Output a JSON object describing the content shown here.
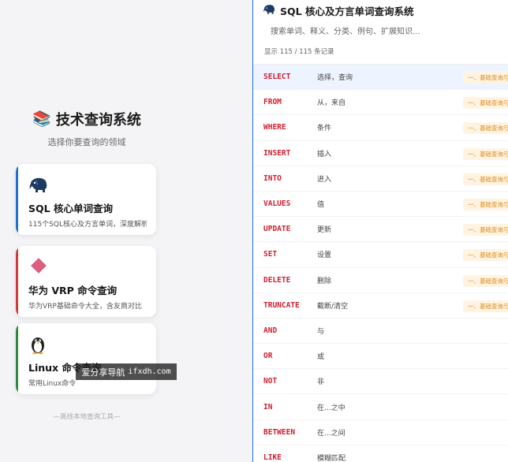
{
  "home": {
    "title": "技术查询系统",
    "subtitle": "选择你要查询的领域",
    "footer": "—离线本地查询工具—",
    "cards": [
      {
        "title": "SQL 核心单词查询",
        "desc": "115个SQL核心及方言单词，深度解析"
      },
      {
        "title": "华为 VRP 命令查询",
        "desc": "华为VRP基础命令大全，含友商对比"
      },
      {
        "title": "Linux 命令查询",
        "desc": "常用Linux命令"
      }
    ]
  },
  "watermark": {
    "text": "爱分享导航",
    "url": "ifxdh.com"
  },
  "panel": {
    "title": "SQL 核心及方言单词查询系统",
    "search_placeholder": "搜索单词、释义、分类、例句、扩展知识...",
    "count": "显示 115 / 115 条记录",
    "rows": [
      {
        "kw": "SELECT",
        "meaning": "选择，查询",
        "tag": "一、基础查询与"
      },
      {
        "kw": "FROM",
        "meaning": "从，来自",
        "tag": "一、基础查询与"
      },
      {
        "kw": "WHERE",
        "meaning": "条件",
        "tag": "一、基础查询与"
      },
      {
        "kw": "INSERT",
        "meaning": "插入",
        "tag": "一、基础查询与"
      },
      {
        "kw": "INTO",
        "meaning": "进入",
        "tag": "一、基础查询与"
      },
      {
        "kw": "VALUES",
        "meaning": "值",
        "tag": "一、基础查询与"
      },
      {
        "kw": "UPDATE",
        "meaning": "更新",
        "tag": "一、基础查询与"
      },
      {
        "kw": "SET",
        "meaning": "设置",
        "tag": "一、基础查询与"
      },
      {
        "kw": "DELETE",
        "meaning": "删除",
        "tag": "一、基础查询与"
      },
      {
        "kw": "TRUNCATE",
        "meaning": "截断/清空",
        "tag": "一、基础查询与"
      },
      {
        "kw": "AND",
        "meaning": "与",
        "tag": ""
      },
      {
        "kw": "OR",
        "meaning": "或",
        "tag": ""
      },
      {
        "kw": "NOT",
        "meaning": "非",
        "tag": ""
      },
      {
        "kw": "IN",
        "meaning": "在...之中",
        "tag": ""
      },
      {
        "kw": "BETWEEN",
        "meaning": "在...之间",
        "tag": ""
      },
      {
        "kw": "LIKE",
        "meaning": "模糊匹配",
        "tag": ""
      }
    ],
    "selected_index": 0
  },
  "colors": {
    "sql_accent": "#1e6fd9",
    "vrp_accent": "#d43a3a",
    "linux_accent": "#2e8a3e",
    "keyword": "#cf2030",
    "tag_bg": "#fff4e2",
    "tag_text": "#d98a1e"
  },
  "icons": {
    "brand": "books-icon",
    "sql": "elephant-icon",
    "vrp": "diamond-icon",
    "linux": "penguin-icon"
  }
}
